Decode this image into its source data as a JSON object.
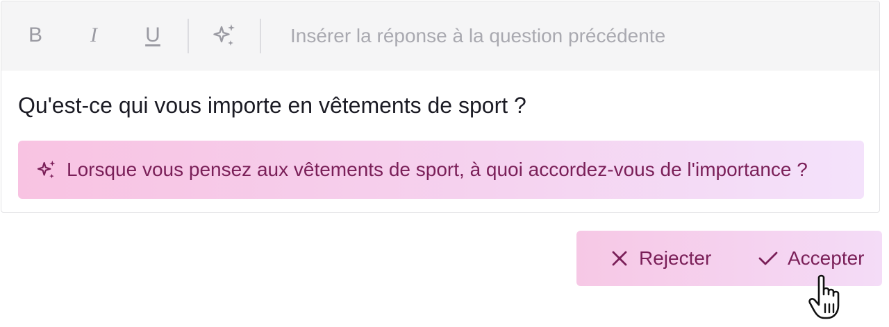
{
  "toolbar": {
    "bold_label": "B",
    "italic_label": "I",
    "underline_label": "U",
    "placeholder": "Insérer la réponse à la question précédente"
  },
  "content": {
    "question": "Qu'est-ce qui vous importe en vêtements de sport ?",
    "suggestion": "Lorsque vous pensez aux vêtements de sport, à quoi accordez-vous de l'importance ?"
  },
  "actions": {
    "reject_label": "Rejecter",
    "accept_label": "Accepter"
  },
  "colors": {
    "accent_text": "#7a1f58",
    "accent_bg": "#f8c3e2",
    "toolbar_bg": "#f5f5f6",
    "placeholder": "#a9a9b0"
  },
  "icons": {
    "bold": "bold-icon",
    "italic": "italic-icon",
    "underline": "underline-icon",
    "ai": "sparkles-icon",
    "reject": "close-icon",
    "accept": "check-icon",
    "pointer": "hand-pointer-icon"
  }
}
